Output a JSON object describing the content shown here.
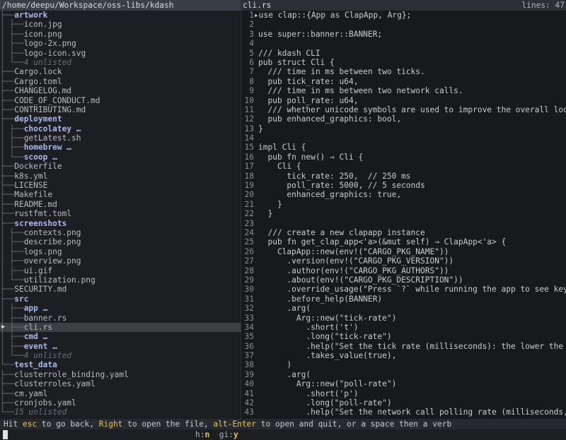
{
  "tree": {
    "root": "/home/deepu/Workspace/oss-libs/kdash",
    "rows": [
      {
        "guide": "├──",
        "name": "artwork",
        "kind": "dir"
      },
      {
        "guide": "│  ├──",
        "name": "icon.jpg",
        "kind": "file"
      },
      {
        "guide": "│  ├──",
        "name": "icon.png",
        "kind": "file"
      },
      {
        "guide": "│  ├──",
        "name": "logo-2x.png",
        "kind": "file"
      },
      {
        "guide": "│  ├──",
        "name": "logo-icon.svg",
        "kind": "file"
      },
      {
        "guide": "│  └──",
        "name": "4 unlisted",
        "kind": "unlisted"
      },
      {
        "guide": "├──",
        "name": "Cargo.lock",
        "kind": "file"
      },
      {
        "guide": "├──",
        "name": "Cargo.toml",
        "kind": "file"
      },
      {
        "guide": "├──",
        "name": "CHANGELOG.md",
        "kind": "file"
      },
      {
        "guide": "├──",
        "name": "CODE_OF_CONDUCT.md",
        "kind": "file"
      },
      {
        "guide": "├──",
        "name": "CONTRIBUTING.md",
        "kind": "file"
      },
      {
        "guide": "├──",
        "name": "deployment",
        "kind": "dir"
      },
      {
        "guide": "│  ├──",
        "name": "chocolatey …",
        "kind": "dir"
      },
      {
        "guide": "│  ├──",
        "name": "getLatest.sh",
        "kind": "file"
      },
      {
        "guide": "│  ├──",
        "name": "homebrew …",
        "kind": "dir"
      },
      {
        "guide": "│  └──",
        "name": "scoop …",
        "kind": "dir"
      },
      {
        "guide": "├──",
        "name": "Dockerfile",
        "kind": "file"
      },
      {
        "guide": "├──",
        "name": "k8s.yml",
        "kind": "file"
      },
      {
        "guide": "├──",
        "name": "LICENSE",
        "kind": "file"
      },
      {
        "guide": "├──",
        "name": "Makefile",
        "kind": "file"
      },
      {
        "guide": "├──",
        "name": "README.md",
        "kind": "file"
      },
      {
        "guide": "├──",
        "name": "rustfmt.toml",
        "kind": "file"
      },
      {
        "guide": "├──",
        "name": "screenshots",
        "kind": "dir"
      },
      {
        "guide": "│  ├──",
        "name": "contexts.png",
        "kind": "file"
      },
      {
        "guide": "│  ├──",
        "name": "describe.png",
        "kind": "file"
      },
      {
        "guide": "│  ├──",
        "name": "logs.png",
        "kind": "file"
      },
      {
        "guide": "│  ├──",
        "name": "overview.png",
        "kind": "file"
      },
      {
        "guide": "│  ├──",
        "name": "ui.gif",
        "kind": "file"
      },
      {
        "guide": "│  └──",
        "name": "utilization.png",
        "kind": "file"
      },
      {
        "guide": "├──",
        "name": "SECURITY.md",
        "kind": "file"
      },
      {
        "guide": "├──",
        "name": "src",
        "kind": "dir"
      },
      {
        "guide": "│  ├──",
        "name": "app …",
        "kind": "dir"
      },
      {
        "guide": "│  ├──",
        "name": "banner.rs",
        "kind": "file"
      },
      {
        "guide": "│  ├──",
        "name": "cli.rs",
        "kind": "file",
        "selected": true
      },
      {
        "guide": "│  ├──",
        "name": "cmd …",
        "kind": "dir"
      },
      {
        "guide": "│  ├──",
        "name": "event …",
        "kind": "dir"
      },
      {
        "guide": "│  └──",
        "name": "4 unlisted",
        "kind": "unlisted"
      },
      {
        "guide": "└──",
        "name": "test_data",
        "kind": "dir"
      },
      {
        "guide": "   ├──",
        "name": "clusterrole_binding.yaml",
        "kind": "file"
      },
      {
        "guide": "   ├──",
        "name": "clusterroles.yaml",
        "kind": "file"
      },
      {
        "guide": "   ├──",
        "name": "cm.yaml",
        "kind": "file"
      },
      {
        "guide": "   ├──",
        "name": "cronjobs.yaml",
        "kind": "file"
      },
      {
        "guide": "   └──",
        "name": "15 unlisted",
        "kind": "unlisted"
      }
    ]
  },
  "preview": {
    "title": "cli.rs",
    "lines_label": "lines: 47",
    "rows": [
      {
        "n": "1",
        "t": "use clap::{App as ClapApp, Arg};"
      },
      {
        "n": "2",
        "t": ""
      },
      {
        "n": "3",
        "t": "use super::banner::BANNER;"
      },
      {
        "n": "4",
        "t": ""
      },
      {
        "n": "5",
        "t": "/// kdash CLI"
      },
      {
        "n": "6",
        "t": "pub struct Cli {"
      },
      {
        "n": "7",
        "t": "  /// time in ms between two ticks."
      },
      {
        "n": "8",
        "t": "  pub tick_rate: u64,"
      },
      {
        "n": "9",
        "t": "  /// time in ms between two network calls."
      },
      {
        "n": "10",
        "t": "  pub poll_rate: u64,"
      },
      {
        "n": "11",
        "t": "  /// whether unicode symbols are used to improve the overall look"
      },
      {
        "n": "12",
        "t": "  pub enhanced_graphics: bool,"
      },
      {
        "n": "13",
        "t": "}"
      },
      {
        "n": "14",
        "t": ""
      },
      {
        "n": "15",
        "t": "impl Cli {"
      },
      {
        "n": "16",
        "t": "  pub fn new() → Cli {"
      },
      {
        "n": "17",
        "t": "    Cli {"
      },
      {
        "n": "18",
        "t": "      tick_rate: 250,  // 250 ms"
      },
      {
        "n": "19",
        "t": "      poll_rate: 5000, // 5 seconds"
      },
      {
        "n": "20",
        "t": "      enhanced_graphics: true,"
      },
      {
        "n": "21",
        "t": "    }"
      },
      {
        "n": "22",
        "t": "  }"
      },
      {
        "n": "23",
        "t": ""
      },
      {
        "n": "24",
        "t": "  /// create a new clapapp instance"
      },
      {
        "n": "25",
        "t": "  pub fn get_clap_app<'a>(&mut self) → ClapApp<'a> {"
      },
      {
        "n": "26",
        "t": "    ClapApp::new(env!(\"CARGO_PKG_NAME\"))"
      },
      {
        "n": "27",
        "t": "      .version(env!(\"CARGO_PKG_VERSION\"))"
      },
      {
        "n": "28",
        "t": "      .author(env!(\"CARGO_PKG_AUTHORS\"))"
      },
      {
        "n": "29",
        "t": "      .about(env!(\"CARGO_PKG_DESCRIPTION\"))"
      },
      {
        "n": "30",
        "t": "      .override_usage(\"Press `?` while running the app to see keyb"
      },
      {
        "n": "31",
        "t": "      .before_help(BANNER)"
      },
      {
        "n": "32",
        "t": "      .arg("
      },
      {
        "n": "33",
        "t": "        Arg::new(\"tick-rate\")"
      },
      {
        "n": "34",
        "t": "          .short('t')"
      },
      {
        "n": "35",
        "t": "          .long(\"tick-rate\")"
      },
      {
        "n": "36",
        "t": "          .help(\"Set the tick rate (milliseconds): the lower the n"
      },
      {
        "n": "37",
        "t": "          .takes_value(true),"
      },
      {
        "n": "38",
        "t": "      )"
      },
      {
        "n": "39",
        "t": "      .arg("
      },
      {
        "n": "40",
        "t": "        Arg::new(\"poll-rate\")"
      },
      {
        "n": "41",
        "t": "          .short('p')"
      },
      {
        "n": "42",
        "t": "          .long(\"poll-rate\")"
      },
      {
        "n": "43",
        "t": "          .help(\"Set the network call polling rate (milliseconds,"
      }
    ]
  },
  "status": {
    "p1": "Hit ",
    "k1": "esc",
    "p2": " to go back, ",
    "k2": "Right",
    "p3": " to open the file, ",
    "k3": "alt-Enter",
    "p4": " to open and quit, or a space then a verb"
  },
  "input": {
    "flag_h_label": "h:",
    "flag_h_value": "n",
    "flag_gi_label": "gi:",
    "flag_gi_value": "y"
  }
}
